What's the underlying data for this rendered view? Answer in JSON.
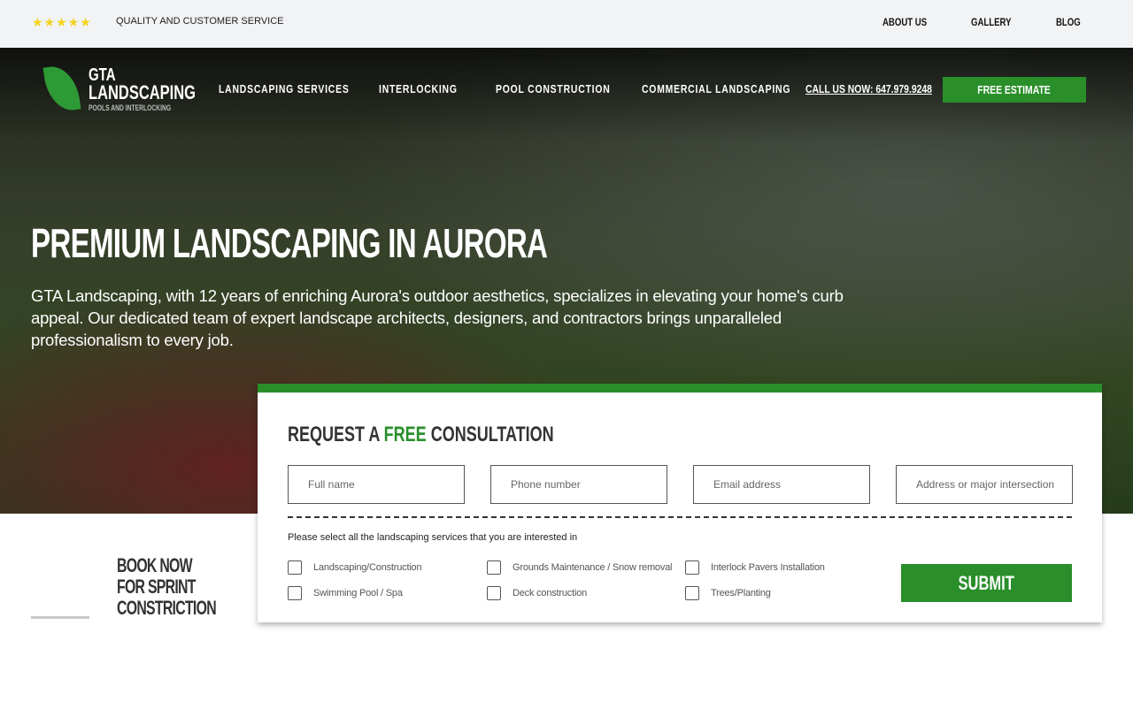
{
  "topbar": {
    "rating_stars": 5,
    "tagline": "QUALITY AND CUSTOMER SERVICE",
    "links": [
      "ABOUT US",
      "GALLERY",
      "BLOG"
    ]
  },
  "header": {
    "logo": {
      "line1": "GTA",
      "line2": "LANDSCAPING",
      "line3": "POOLS AND INTERLOCKING"
    },
    "nav": [
      "LANDSCAPING SERVICES",
      "INTERLOCKING",
      "POOL CONSTRUCTION",
      "COMMERCIAL LANDSCAPING"
    ],
    "call": "CALL US NOW: 647.979.9248",
    "estimate": "FREE ESTIMATE"
  },
  "hero": {
    "title": "PREMIUM LANDSCAPING IN AURORA",
    "text": "GTA Landscaping, with 12 years of enriching Aurora's outdoor aesthetics, specializes in elevating your home's curb appeal. Our dedicated team of expert landscape architects, designers, and contractors brings unparalleled professionalism to every job."
  },
  "form": {
    "title_pre": "REQUEST A ",
    "title_accent": "FREE",
    "title_post": " CONSULTATION",
    "placeholders": [
      "Full name",
      "Phone number",
      "Email address",
      "Address or major intersection"
    ],
    "prompt": "Please select all the landscaping services that you are interested in",
    "services": [
      "Landscaping/Construction",
      "Grounds Maintenance / Snow removal",
      "Interlock Pavers Installation",
      "Swimming Pool / Spa",
      "Deck construction",
      "Trees/Planting"
    ],
    "submit": "SUBMIT"
  },
  "promo": {
    "line1": "BOOK NOW",
    "line2": "FOR SPRINT",
    "line3": "CONSTRICTION"
  },
  "colors": {
    "accent": "#2a8f2a",
    "star": "#f3d21c"
  }
}
